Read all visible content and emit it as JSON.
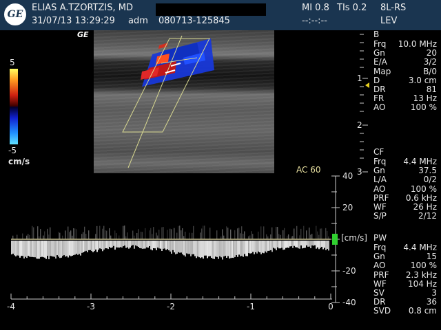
{
  "header": {
    "operator": "ELIAS A.TZORTZIS, MD",
    "datetime": "31/07/13 13:29:29",
    "user": "adm",
    "exam_id": "080713-125845",
    "mi": "MI 0.8",
    "tis": "TIs 0.2",
    "probe": "8L-RS",
    "preset": "LEV",
    "time_placeholder": "--:--:--"
  },
  "logo": {
    "text": "GE"
  },
  "image": {
    "ge_mark": "GE"
  },
  "colorbar": {
    "top": "5",
    "bottom": "-5",
    "unit": "cm/s",
    "colors": [
      "#ffff60",
      "#d02010",
      "#1020d0",
      "#60e0ff"
    ]
  },
  "depth_scale": {
    "ticks": [
      "1",
      "2",
      "3"
    ]
  },
  "params": {
    "b": {
      "title": "B",
      "items": [
        {
          "k": "Frq",
          "v": "10.0 MHz"
        },
        {
          "k": "Gn",
          "v": "20"
        },
        {
          "k": "E/A",
          "v": "3/2"
        },
        {
          "k": "Map",
          "v": "B/0"
        },
        {
          "k": "D",
          "v": "3.0 cm"
        },
        {
          "k": "DR",
          "v": "81"
        },
        {
          "k": "FR",
          "v": "13 Hz"
        },
        {
          "k": "AO",
          "v": "100 %"
        }
      ]
    },
    "cf": {
      "title": "CF",
      "items": [
        {
          "k": "Frq",
          "v": "4.4 MHz"
        },
        {
          "k": "Gn",
          "v": "37.5"
        },
        {
          "k": "L/A",
          "v": "0/2"
        },
        {
          "k": "AO",
          "v": "100 %"
        },
        {
          "k": "PRF",
          "v": "0.6 kHz"
        },
        {
          "k": "WF",
          "v": "26 Hz"
        },
        {
          "k": "S/P",
          "v": "2/12"
        }
      ]
    },
    "pw": {
      "title": "PW",
      "items": [
        {
          "k": "Frq",
          "v": "4.4 MHz"
        },
        {
          "k": "Gn",
          "v": "15"
        },
        {
          "k": "AO",
          "v": "100 %"
        },
        {
          "k": "PRF",
          "v": "2.3 kHz"
        },
        {
          "k": "WF",
          "v": "104 Hz"
        },
        {
          "k": "SV",
          "v": "3"
        },
        {
          "k": "DR",
          "v": "36"
        },
        {
          "k": "SVD",
          "v": "0.8 cm"
        }
      ]
    }
  },
  "angle_correction": "AC 60",
  "spectrum": {
    "velocity_ticks": [
      "40",
      "20",
      "-20",
      "-40"
    ],
    "velocity_values": [
      40,
      20,
      -20,
      -40
    ],
    "unit": "[cm/s]",
    "time_ticks": [
      "-4",
      "-3",
      "-2",
      "-1",
      "0"
    ],
    "time_values": [
      -4,
      -3,
      -2,
      -1,
      0
    ],
    "baseline_color": "#c8c090",
    "marker_color": "#30d030"
  }
}
